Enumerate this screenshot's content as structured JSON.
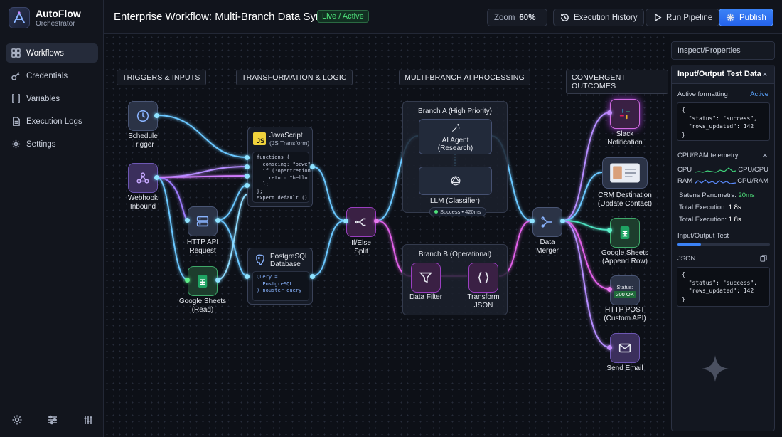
{
  "app": {
    "name": "AutoFlow",
    "subtitle": "Orchestrator"
  },
  "sidebar": {
    "items": [
      {
        "label": "Workflows",
        "icon": "grid-icon",
        "active": true
      },
      {
        "label": "Credentials",
        "icon": "key-icon"
      },
      {
        "label": "Variables",
        "icon": "brackets-icon"
      },
      {
        "label": "Execution Logs",
        "icon": "document-icon"
      },
      {
        "label": "Settings",
        "icon": "gear-icon"
      }
    ],
    "bottom_icons": [
      "gear-icon",
      "sliders-icon",
      "equalizer-icon"
    ]
  },
  "header": {
    "title": "Enterprise Workflow: Multi-Branch Data Sync",
    "status": "Live / Active",
    "zoom_label": "Zoom",
    "zoom_value": "60%",
    "history_label": "Execution History",
    "run_label": "Run Pipeline",
    "publish_label": "Publish"
  },
  "sections": {
    "triggers": "TRIGGERS & INPUTS",
    "transform": "TRANSFORMATION & LOGIC",
    "ai": "MULTI-BRANCH AI PROCESSING",
    "outcomes": "CONVERGENT OUTCOMES"
  },
  "nodes": {
    "schedule": {
      "l1": "Schedule",
      "l2": "Trigger"
    },
    "webhook": {
      "l1": "Webhook",
      "l2": "Inbound"
    },
    "http_api": {
      "l1": "HTTP API",
      "l2": "Request"
    },
    "gsheets_read": {
      "l1": "Google Sheets",
      "l2": "(Read)"
    },
    "js": {
      "l1": "JavaScript",
      "l2": "(JS Transform)",
      "badge": "JS"
    },
    "postgres": {
      "l1": "PostgreSQL",
      "l2": "Database"
    },
    "ifelse": {
      "l1": "If/Else",
      "l2": "Split"
    },
    "branch_a": {
      "title": "Branch A (High Priority)",
      "agent_l1": "AI Agent",
      "agent_l2": "(Research)",
      "llm": "LLM (Classifier)",
      "pill": "Success • 420ms"
    },
    "branch_b": {
      "title": "Branch B (Operational)",
      "filter_l1": "Data Filter",
      "transform_l1": "Transform",
      "transform_l2": "JSON"
    },
    "merger": {
      "l1": "Data",
      "l2": "Merger"
    },
    "slack": {
      "l1": "Slack",
      "l2": "Notification"
    },
    "crm": {
      "l1": "CRM Destination",
      "l2": "(Update Contact)"
    },
    "gsheets_append": {
      "l1": "Google Sheets",
      "l2": "(Append Row)"
    },
    "http_post": {
      "l1": "HTTP POST",
      "l2": "(Custom API)",
      "status": "Status:",
      "code": "200 OK"
    },
    "email": {
      "l1": "Send Email"
    }
  },
  "code": {
    "js_lines": [
      "functions {",
      "  conscing: \"ocwe\"",
      "  if (:opertretion",
      "    return \"hello.",
      "  };",
      "};",
      "expert default ()"
    ],
    "pg_lines": [
      "Query =",
      "  PostgreSQL",
      ") nouster query"
    ]
  },
  "panel": {
    "header": "Inspect/Properties",
    "section_title": "Input/Output Test Data",
    "active_formatting_label": "Active formatting",
    "active_formatting_value": "Active",
    "json_top": [
      "{",
      "  \"status\": \"success\",",
      "  \"rows_updated\": 142",
      "}"
    ],
    "telemetry_title": "CPU/RAM telemetry",
    "cpu_label": "CPU",
    "cpu_value": "CPU/CPU",
    "ram_label": "RAM",
    "ram_value": "CPU/RAM",
    "metric1_label": "Satens Panometrs:",
    "metric1_value": "20ms",
    "metric2_label": "Total Execution:",
    "metric2_value": "1.8s",
    "metric3_label": "Total Execution:",
    "metric3_value": "1.8s",
    "io_label": "Input/Output Test",
    "json_label": "JSON",
    "json_bottom": [
      "{",
      "  \"status\": \"success\",",
      "  \"rows_updated\": 142",
      "}"
    ]
  }
}
